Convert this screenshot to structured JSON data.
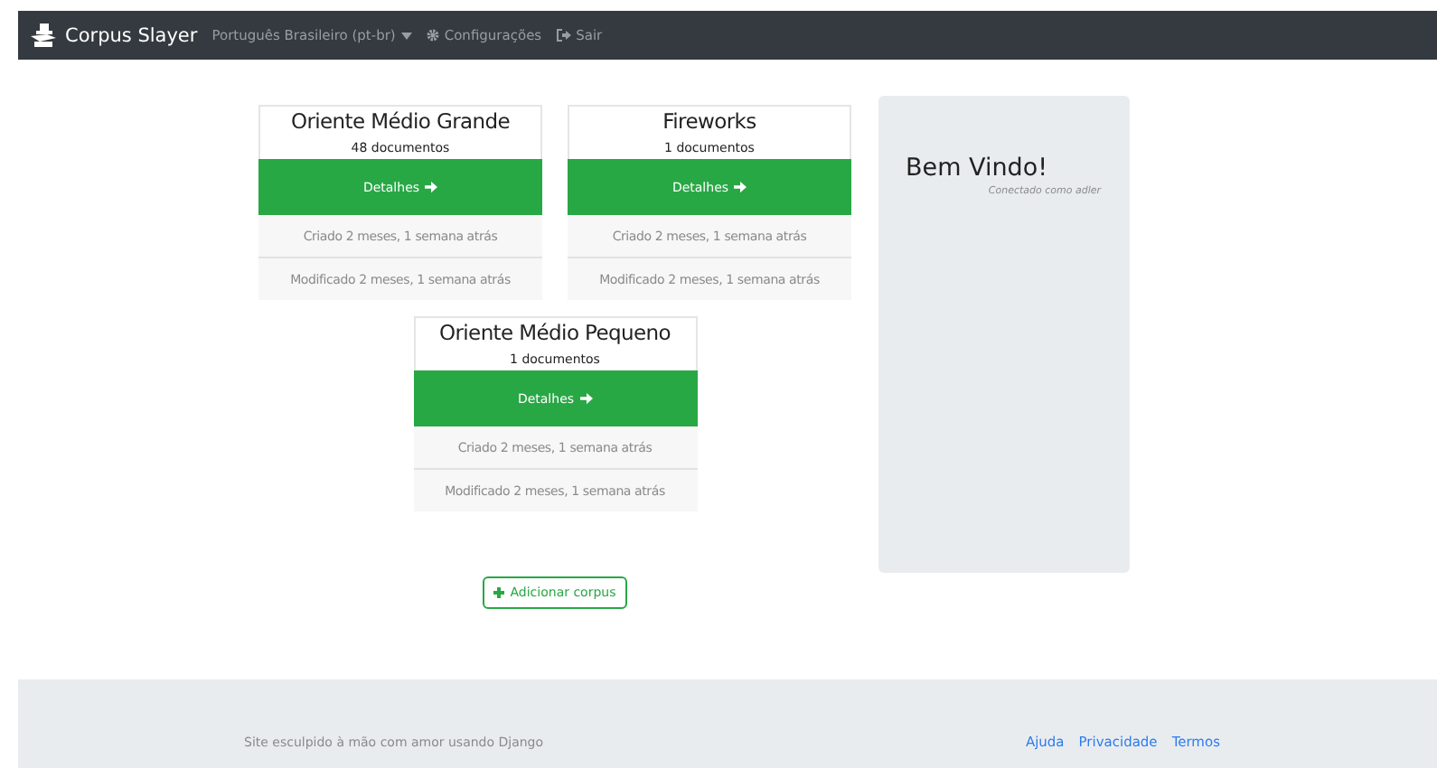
{
  "navbar": {
    "brand": "Corpus Slayer",
    "language": "Português Brasileiro (pt-br)",
    "settings": "Configurações",
    "logout": "Sair"
  },
  "corpora": [
    {
      "title": "Oriente Médio Grande",
      "count": "48 documentos",
      "button": "Detalhes",
      "created": "Criado 2 meses, 1 semana atrás",
      "modified": "Modificado 2 meses, 1 semana atrás"
    },
    {
      "title": "Fireworks",
      "count": "1 documentos",
      "button": "Detalhes",
      "created": "Criado 2 meses, 1 semana atrás",
      "modified": "Modificado 2 meses, 1 semana atrás"
    },
    {
      "title": "Oriente Médio Pequeno",
      "count": "1 documentos",
      "button": "Detalhes",
      "created": "Criado 2 meses, 1 semana atrás",
      "modified": "Modificado 2 meses, 1 semana atrás"
    }
  ],
  "add_button": "Adicionar corpus",
  "welcome": {
    "title": "Bem Vindo!",
    "subtitle": "Conectado como adler"
  },
  "footer": {
    "text": "Site esculpido à mão com amor usando Django",
    "links": [
      "Ajuda",
      "Privacidade",
      "Termos"
    ]
  }
}
